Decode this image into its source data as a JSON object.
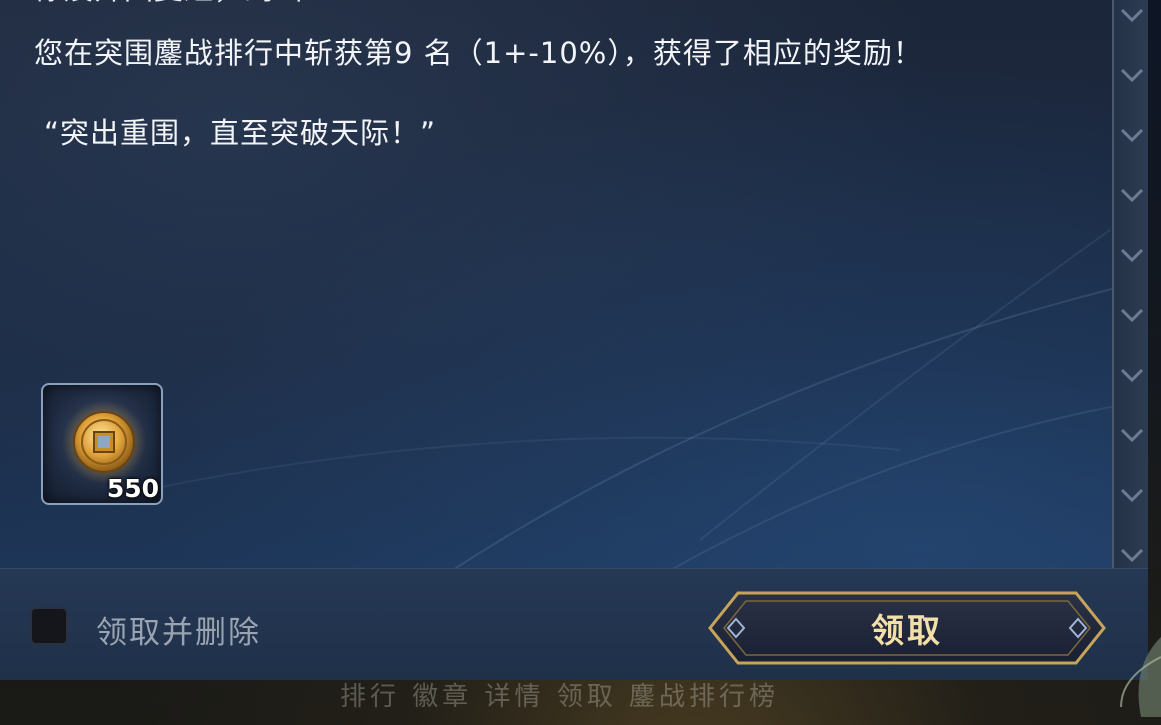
{
  "mail": {
    "cut_off_line": "你展开回复短，剑叫",
    "body_line_1": "您在突围鏖战排行中斩获第9 名（1+-10%），获得了相应的奖励！",
    "body_line_2": "“突出重围，直至突破天际！”"
  },
  "reward": {
    "icon": "gold-coin-icon",
    "quantity": "550"
  },
  "actions": {
    "claim_and_delete_label": "领取并删除",
    "claim_and_delete_checked": false,
    "claim_label": "领取"
  },
  "colors": {
    "panel_bg": "#1c2639",
    "button_border_gold": "#c8a45a",
    "button_text": "#f3dfa8",
    "coin_gold": "#e0a23a"
  },
  "background_tabs_text": "排行 徽章 详情 领取 鏖战排行榜"
}
